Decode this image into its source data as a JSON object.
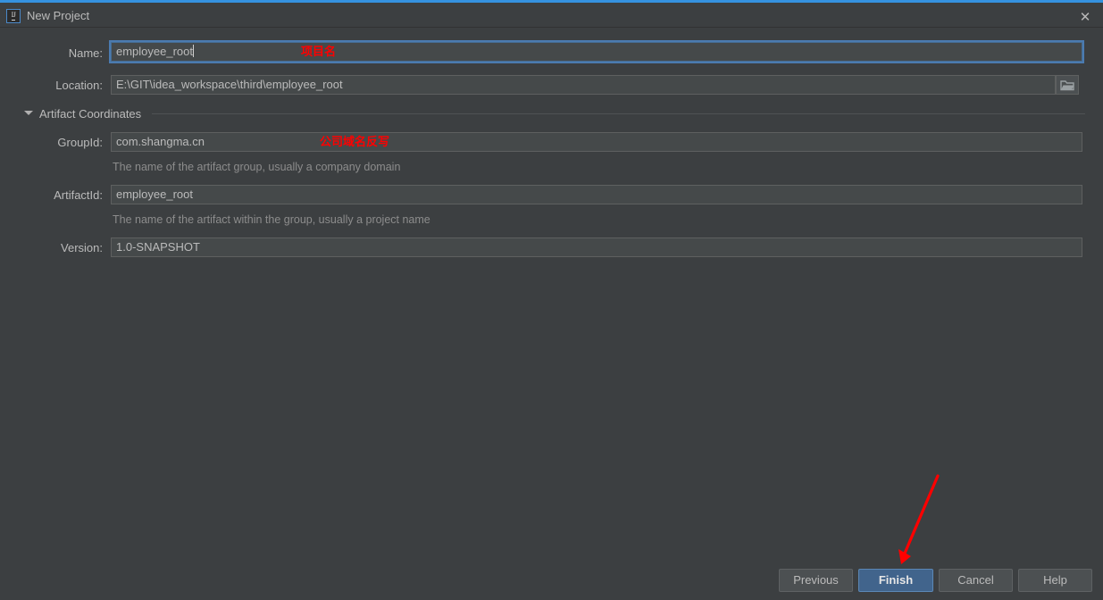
{
  "window": {
    "title": "New Project",
    "app_icon": "intellij-idea-icon",
    "close_icon": "close-icon",
    "accent_color": "#3592e0",
    "background_color": "#3c3f41"
  },
  "form": {
    "name": {
      "label": "Name:",
      "value": "employee_root",
      "focused": true
    },
    "location": {
      "label": "Location:",
      "value": "E:\\GIT\\idea_workspace\\third\\employee_root",
      "browse_icon": "folder-icon"
    }
  },
  "section": {
    "title": "Artifact Coordinates",
    "expanded": true,
    "toggle_icon": "chevron-down-icon",
    "fields": [
      {
        "label": "GroupId:",
        "value": "com.shangma.cn",
        "hint": "The name of the artifact group, usually a company domain"
      },
      {
        "label": "ArtifactId:",
        "value": "employee_root",
        "hint": "The name of the artifact within the group, usually a project name"
      },
      {
        "label": "Version:",
        "value": "1.0-SNAPSHOT",
        "hint": ""
      }
    ]
  },
  "annotations": {
    "color": "#ff0000",
    "name_note": "项目名",
    "groupid_note": "公司域名反写",
    "arrow": "red-arrow-pointing-to-finish"
  },
  "buttons": {
    "previous": "Previous",
    "finish": "Finish",
    "cancel": "Cancel",
    "help": "Help",
    "primary_color": "#41648c"
  }
}
